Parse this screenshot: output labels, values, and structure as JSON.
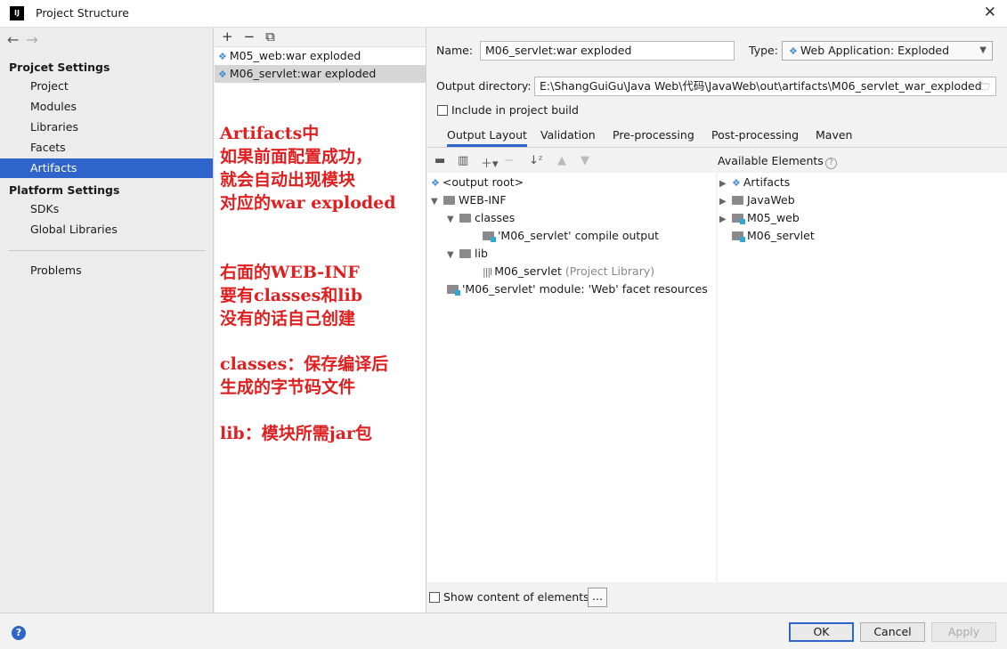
{
  "window": {
    "logo": "IJ",
    "title": "Project Structure",
    "close": "✕"
  },
  "nav": {
    "back": "←",
    "forward": "→"
  },
  "sidebar": {
    "project_settings_label": "Projcet Settings",
    "project_items": [
      "Project",
      "Modules",
      "Libraries",
      "Facets",
      "Artifacts"
    ],
    "platform_settings_label": "Platform Settings",
    "platform_items": [
      "SDKs",
      "Global Libraries"
    ],
    "problems_label": "Problems",
    "selected": "Artifacts"
  },
  "artifacts_panel": {
    "toolbar": {
      "add": "+",
      "remove": "−",
      "copy": "⧉"
    },
    "items": [
      "M05_web:war exploded",
      "M06_servlet:war exploded"
    ],
    "selected_index": 1
  },
  "annotations": {
    "block1": "Artifacts中\n如果前面配置成功，\n就会自动出现模块\n对应的war exploded",
    "block2": "右面的WEB-INF\n要有classes和lib\n没有的话自己创建",
    "block3": "classes：保存编译后\n生成的字节码文件",
    "block4": "lib：模块所需jar包"
  },
  "form": {
    "name_label": "Name:",
    "name_value": "M06_servlet:war exploded",
    "type_label": "Type:",
    "type_value": "Web Application: Exploded",
    "output_dir_label": "Output directory:",
    "output_dir_value": "E:\\ShangGuiGu\\Java Web\\代码\\JavaWeb\\out\\artifacts\\M06_servlet_war_exploded",
    "include_build_label": "Include in project build",
    "include_build_checked": false
  },
  "tabs": [
    "Output Layout",
    "Validation",
    "Pre-processing",
    "Post-processing",
    "Maven"
  ],
  "active_tab": "Output Layout",
  "output_layout": {
    "root": "<output root>",
    "web_inf": "WEB-INF",
    "classes": "classes",
    "compile_output": "'M06_servlet' compile output",
    "lib": "lib",
    "lib_entry": "M06_servlet",
    "lib_entry_note": "(Project Library)",
    "facet_resources": "'M06_servlet' module: 'Web' facet resources"
  },
  "available_elements": {
    "label": "Available Elements",
    "help": "?",
    "items": [
      "Artifacts",
      "JavaWeb",
      "M05_web",
      "M06_servlet"
    ]
  },
  "show_content_label": "Show content of elements",
  "more_button": "...",
  "buttons": {
    "help": "?",
    "ok": "OK",
    "cancel": "Cancel",
    "apply": "Apply"
  }
}
